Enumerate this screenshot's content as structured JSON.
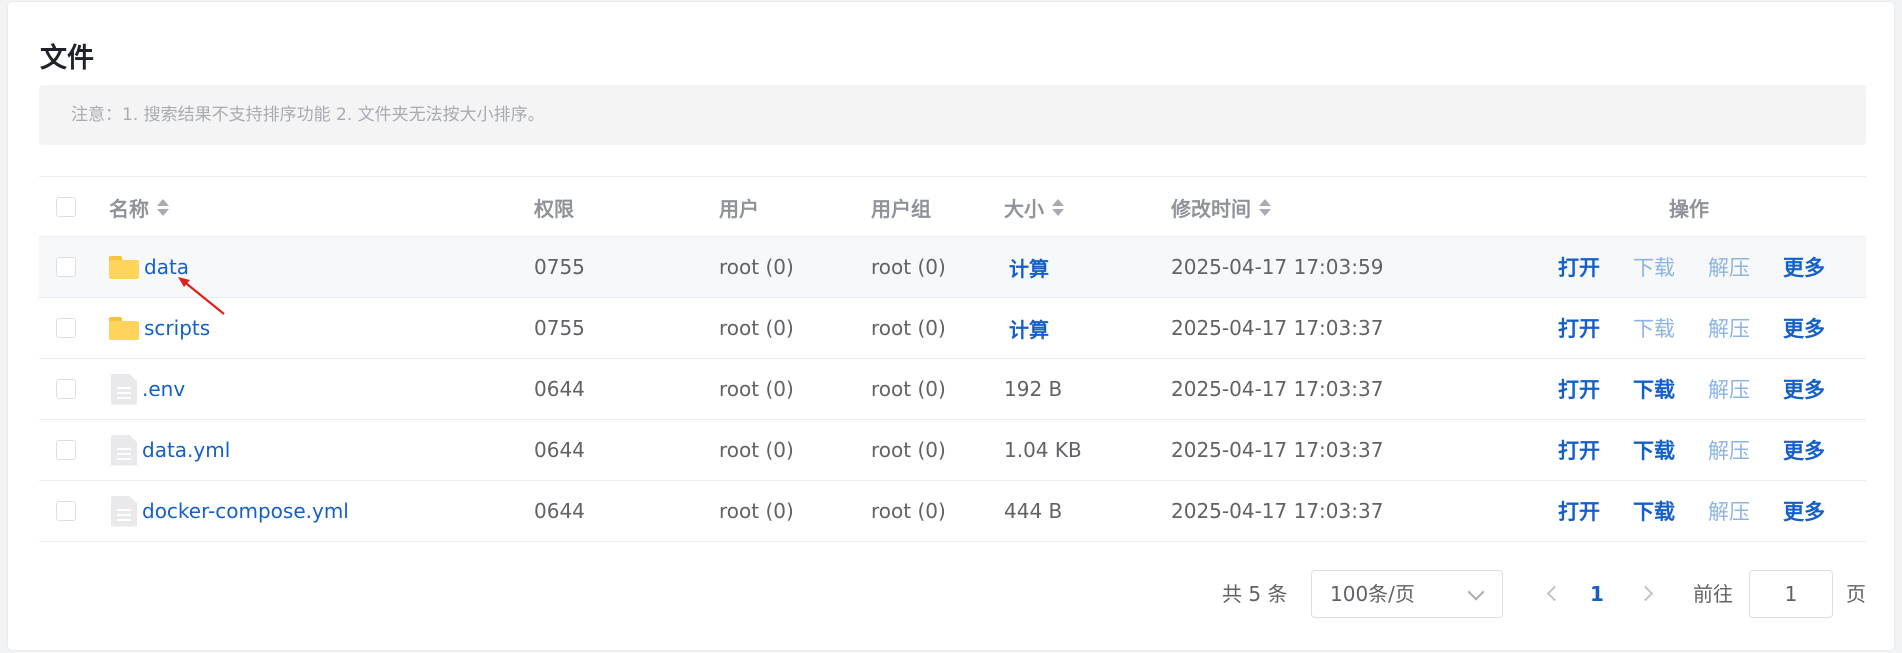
{
  "title": "文件",
  "notice": "注意：1. 搜索结果不支持排序功能 2. 文件夹无法按大小排序。",
  "columns": {
    "name": "名称",
    "permission": "权限",
    "user": "用户",
    "group": "用户组",
    "size": "大小",
    "modified": "修改时间",
    "actions": "操作"
  },
  "rows": [
    {
      "name": "data",
      "type": "folder",
      "permission": "0755",
      "user": "root (0)",
      "group": "root (0)",
      "size": "计算",
      "modified": "2025-04-17 17:03:59",
      "download_enabled": false
    },
    {
      "name": "scripts",
      "type": "folder",
      "permission": "0755",
      "user": "root (0)",
      "group": "root (0)",
      "size": "计算",
      "modified": "2025-04-17 17:03:37",
      "download_enabled": false
    },
    {
      "name": ".env",
      "type": "file",
      "permission": "0644",
      "user": "root (0)",
      "group": "root (0)",
      "size": "192 B",
      "modified": "2025-04-17 17:03:37",
      "download_enabled": true
    },
    {
      "name": "data.yml",
      "type": "file",
      "permission": "0644",
      "user": "root (0)",
      "group": "root (0)",
      "size": "1.04 KB",
      "modified": "2025-04-17 17:03:37",
      "download_enabled": true
    },
    {
      "name": "docker-compose.yml",
      "type": "file",
      "permission": "0644",
      "user": "root (0)",
      "group": "root (0)",
      "size": "444 B",
      "modified": "2025-04-17 17:03:37",
      "download_enabled": true
    }
  ],
  "actions": {
    "open": "打开",
    "download": "下载",
    "extract": "解压",
    "more": "更多"
  },
  "pagination": {
    "total": "共 5 条",
    "page_size": "100条/页",
    "current_page": "1",
    "goto_label": "前往",
    "goto_value": "1",
    "page_suffix": "页"
  },
  "colors": {
    "link": "#1560c8",
    "link_disabled": "#8cb4e3",
    "folder": "#ffd45a",
    "annotation_arrow": "#e0201b"
  }
}
